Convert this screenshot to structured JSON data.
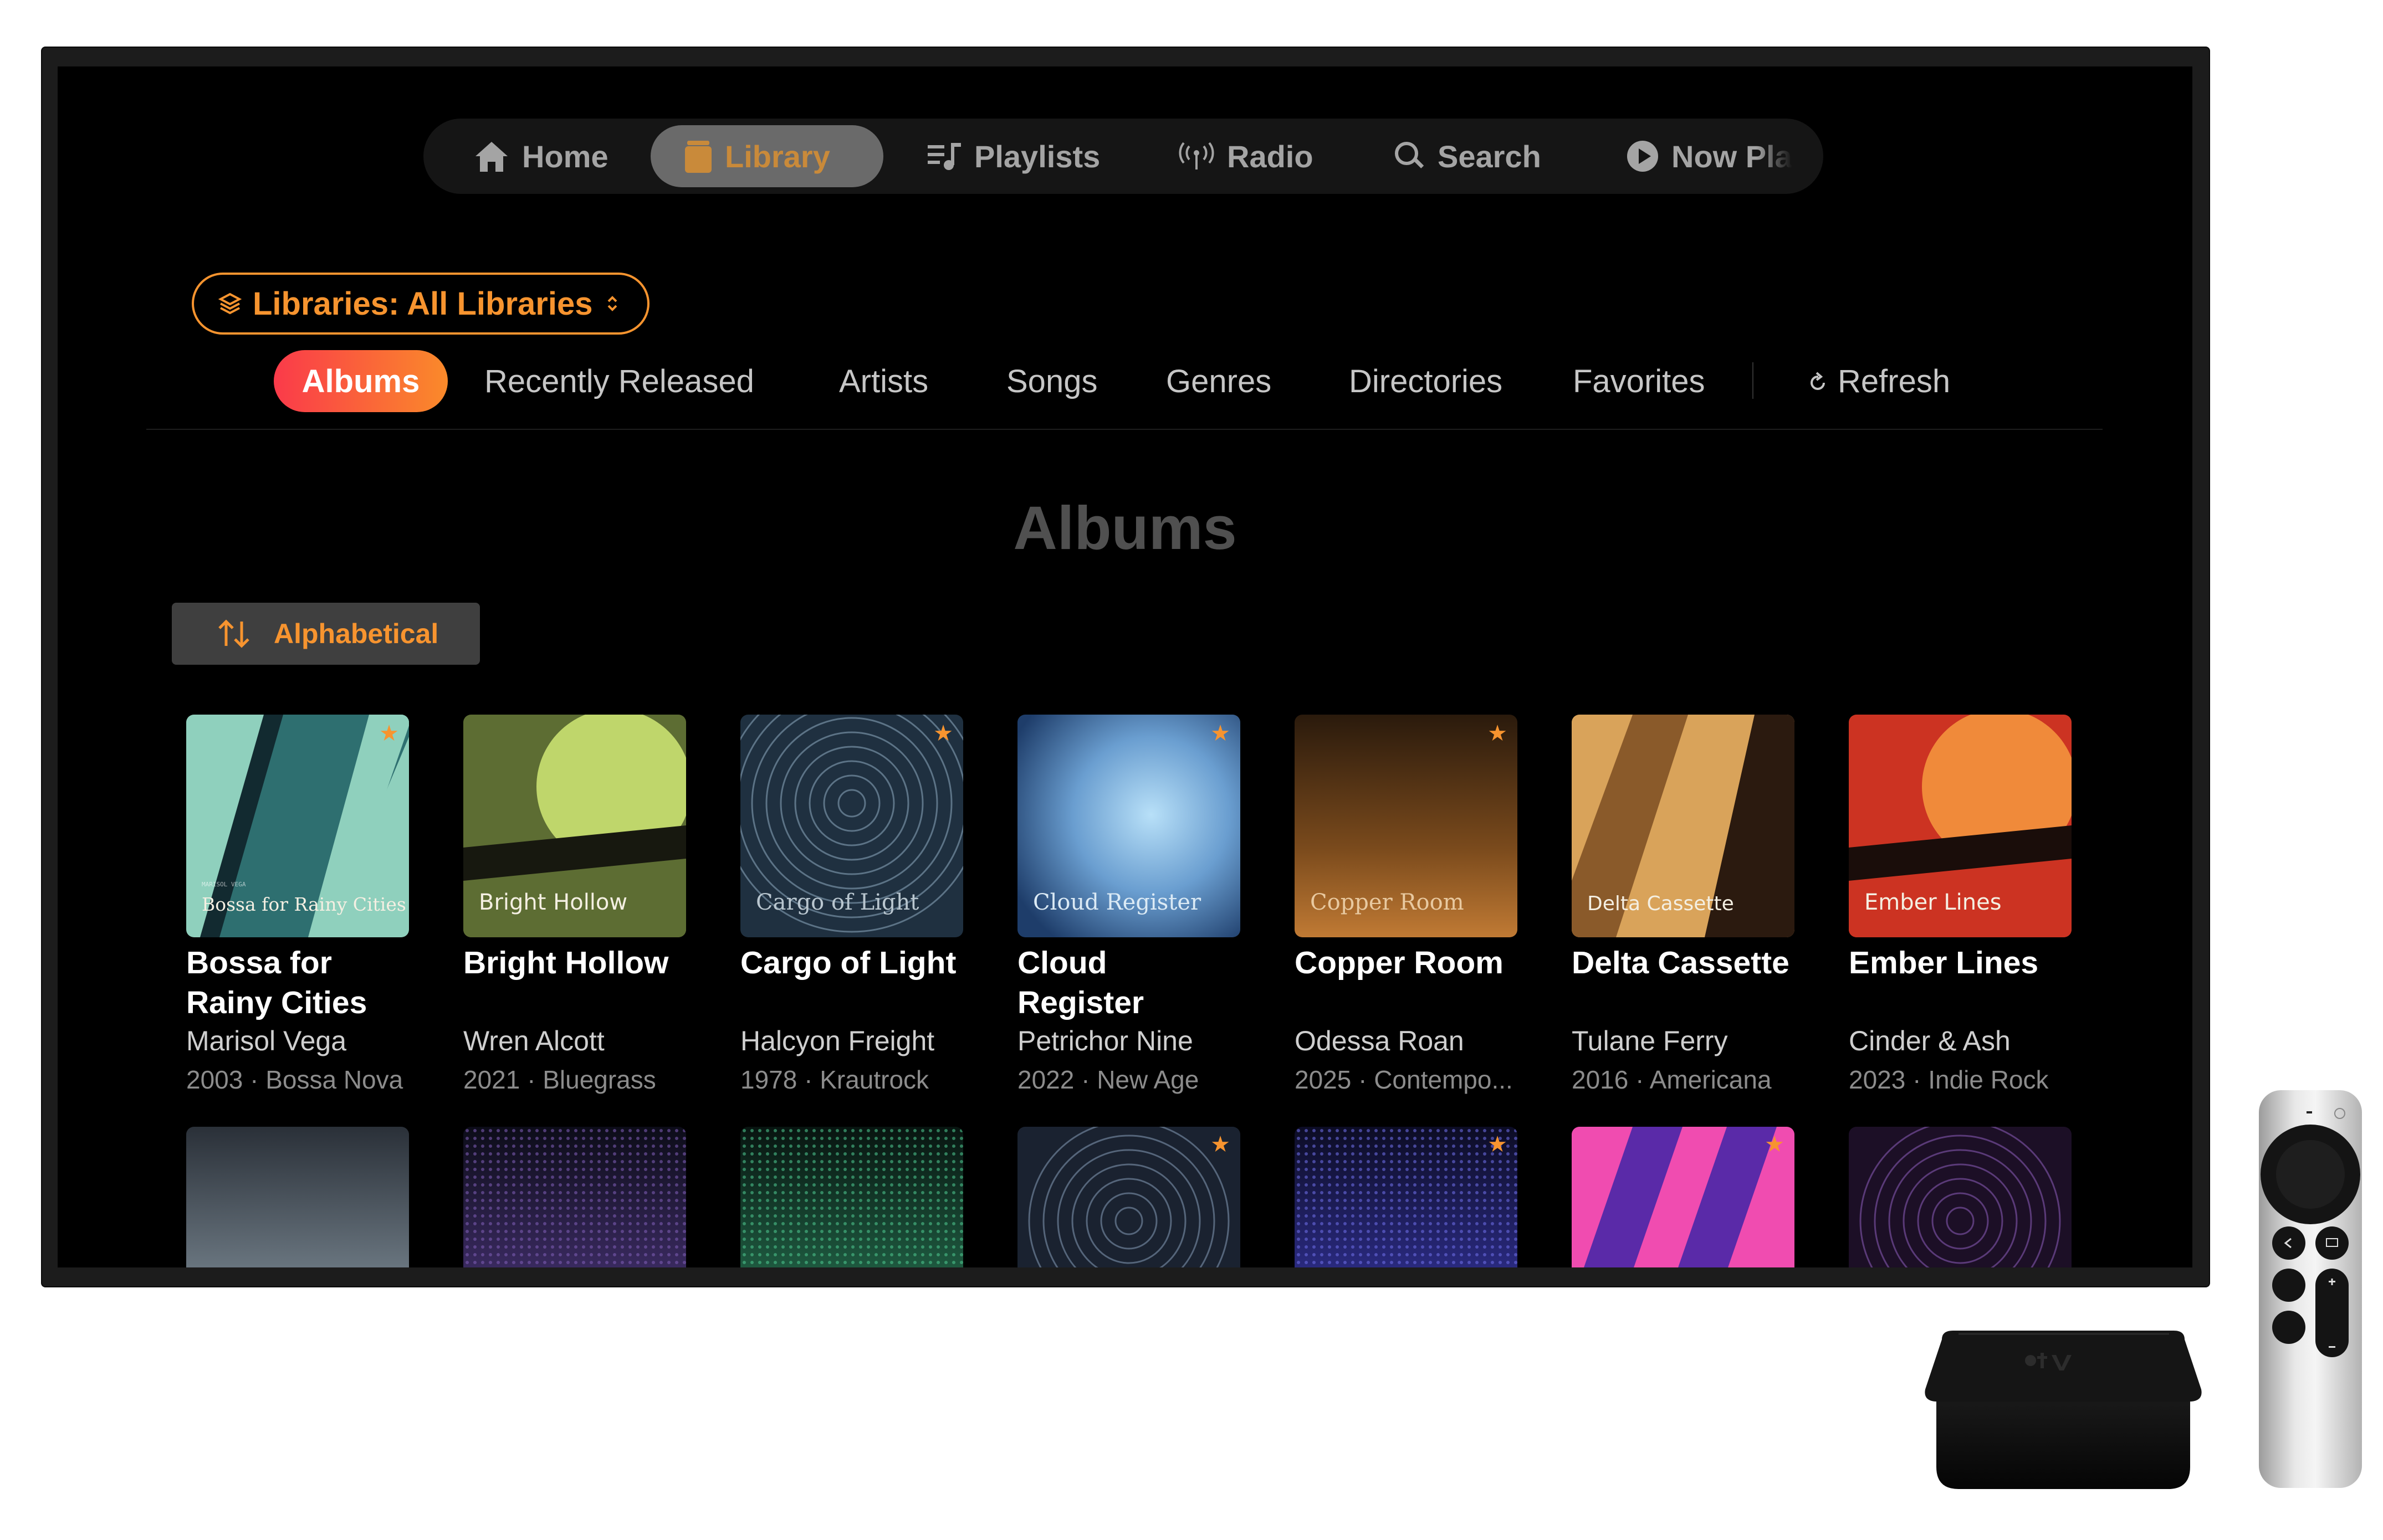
{
  "nav": {
    "items": [
      {
        "label": "Home",
        "icon": "house-icon"
      },
      {
        "label": "Library",
        "icon": "library-icon",
        "selected": true
      },
      {
        "label": "Playlists",
        "icon": "playlist-icon"
      },
      {
        "label": "Radio",
        "icon": "radio-icon"
      },
      {
        "label": "Search",
        "icon": "magnifier-icon"
      },
      {
        "label": "Now Pla",
        "icon": "play-circle-icon"
      }
    ]
  },
  "library_selector": {
    "label": "Libraries: All Libraries",
    "icon": "layers-icon",
    "chevron": "updown-chevron-icon"
  },
  "tabs": [
    {
      "label": "Albums",
      "active": true
    },
    {
      "label": "Recently Released"
    },
    {
      "label": "Artists"
    },
    {
      "label": "Songs"
    },
    {
      "label": "Genres"
    },
    {
      "label": "Directories"
    },
    {
      "label": "Favorites"
    }
  ],
  "refresh": {
    "label": "Refresh",
    "icon": "refresh-icon"
  },
  "page_title": "Albums",
  "sort": {
    "label": "Alphabetical",
    "icon": "sort-arrows-icon"
  },
  "albums": [
    {
      "title": "Bossa for Rainy Cities",
      "cover_text": "Bossa for Rainy Cities",
      "artist": "Marisol Vega",
      "meta": "2003 · Bossa Nova",
      "favorite": true
    },
    {
      "title": "Bright Hollow",
      "cover_text": "Bright Hollow",
      "artist": "Wren Alcott",
      "meta": "2021 · Bluegrass",
      "favorite": false
    },
    {
      "title": "Cargo of Light",
      "cover_text": "Cargo of Light",
      "artist": "Halcyon Freight",
      "meta": "1978 · Krautrock",
      "favorite": true
    },
    {
      "title": "Cloud Register",
      "cover_text": "Cloud Register",
      "artist": "Petrichor Nine",
      "meta": "2022 · New Age",
      "favorite": true
    },
    {
      "title": "Copper Room",
      "cover_text": "Copper Room",
      "artist": "Odessa Roan",
      "meta": "2025 · Contempo...",
      "favorite": true
    },
    {
      "title": "Delta Cassette",
      "cover_text": "Delta Cassette",
      "artist": "Tulane Ferry",
      "meta": "2016 · Americana",
      "favorite": false
    },
    {
      "title": "Ember Lines",
      "cover_text": "Ember Lines",
      "artist": "Cinder & Ash",
      "meta": "2023 · Indie Rock",
      "favorite": false
    }
  ],
  "row2_favorites": [
    false,
    false,
    false,
    true,
    true,
    true,
    false
  ],
  "colors": {
    "accent": "#f7942f",
    "tab_gradient_start": "#fa3a4a",
    "tab_gradient_end": "#fa8a2a",
    "screen_bg": "#000000"
  }
}
